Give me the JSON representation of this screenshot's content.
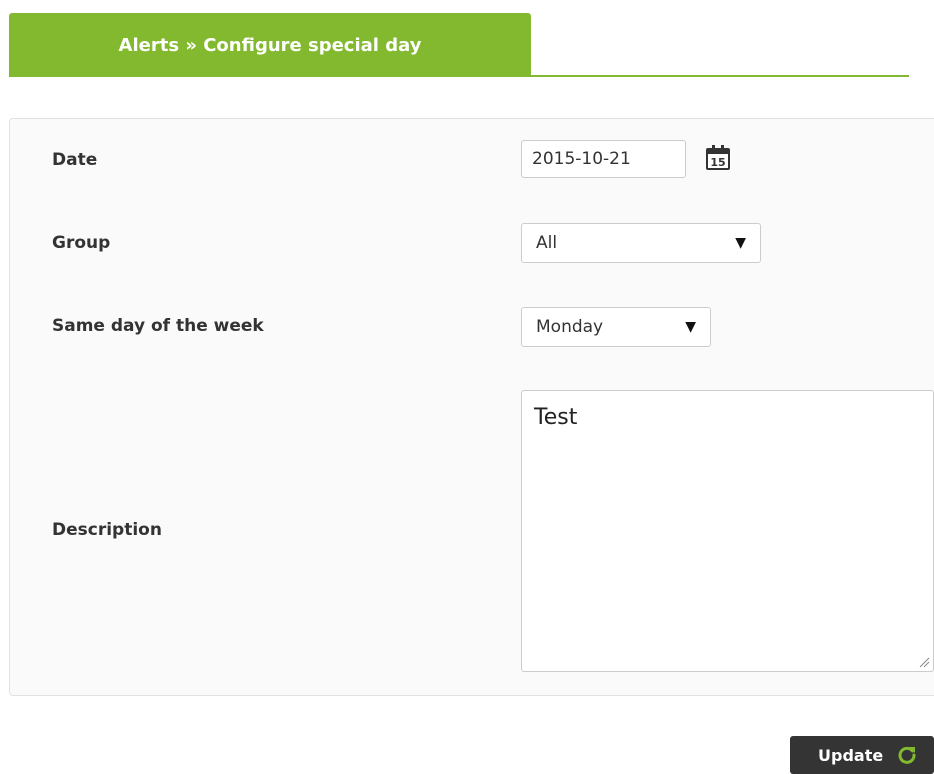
{
  "tab": {
    "title": "Alerts » Configure special day"
  },
  "form": {
    "date": {
      "label": "Date",
      "value": "2015-10-21",
      "calendar_icon": "calendar-icon",
      "calendar_day": "15"
    },
    "group": {
      "label": "Group",
      "value": "All"
    },
    "same_day": {
      "label": "Same day of the week",
      "value": "Monday"
    },
    "description": {
      "label": "Description",
      "value": "Test"
    }
  },
  "actions": {
    "update_label": "Update",
    "update_icon": "refresh-icon"
  },
  "colors": {
    "accent": "#82b92e",
    "button_bg": "#343434"
  }
}
